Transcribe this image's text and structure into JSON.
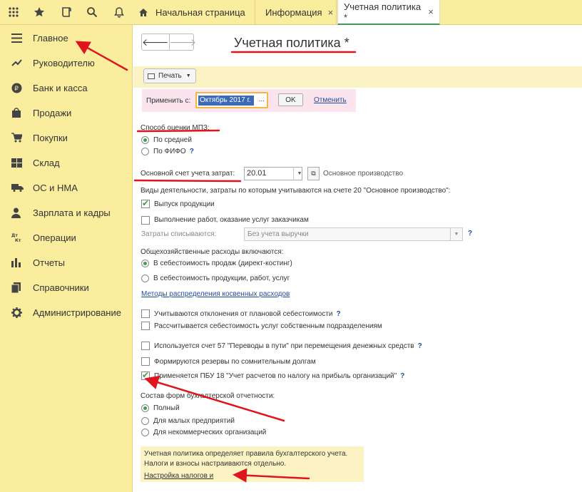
{
  "topbar": {
    "icons": [
      "apps-grid-icon",
      "star-icon",
      "history-icon",
      "search-icon",
      "bell-icon"
    ],
    "tabs": [
      {
        "label": "Начальная страница",
        "icon": "home-icon"
      },
      {
        "label": "Информация",
        "close": "×"
      },
      {
        "label": "Учетная политика *",
        "close": "×"
      }
    ]
  },
  "sidebar": {
    "items": [
      {
        "label": "Главное",
        "icon": "menu-icon"
      },
      {
        "label": "Руководителю",
        "icon": "trend-icon"
      },
      {
        "label": "Банк и касса",
        "icon": "ruble-icon"
      },
      {
        "label": "Продажи",
        "icon": "bag-icon"
      },
      {
        "label": "Покупки",
        "icon": "cart-icon"
      },
      {
        "label": "Склад",
        "icon": "warehouse-icon"
      },
      {
        "label": "ОС и НМА",
        "icon": "truck-icon"
      },
      {
        "label": "Зарплата и кадры",
        "icon": "person-icon"
      },
      {
        "label": "Операции",
        "icon": "dt-kt-icon"
      },
      {
        "label": "Отчеты",
        "icon": "bar-chart-icon"
      },
      {
        "label": "Справочники",
        "icon": "books-icon"
      },
      {
        "label": "Администрирование",
        "icon": "gear-icon"
      }
    ]
  },
  "main": {
    "back": "🡐",
    "forward": "🡒",
    "title": "Учетная политика *",
    "print_label": "Печать",
    "apply": {
      "label": "Применить с:",
      "value": "Октябрь 2017 г.",
      "dots": "...",
      "ok": "OK",
      "cancel": "Отменить"
    },
    "mpz": {
      "label": "Способ оценки МПЗ:",
      "options": [
        "По средней",
        "По ФИФО"
      ],
      "help": "?"
    },
    "account": {
      "label": "Основной счет учета затрат:",
      "value": "20.01",
      "note": "Основное производство"
    },
    "activities": {
      "label": "Виды деятельности, затраты по которым учитываются на счете 20 \"Основное производство\":",
      "items": [
        "Выпуск продукции",
        "Выполнение работ, оказание услуг заказчикам"
      ],
      "writeoff_label": "Затраты списываются:",
      "writeoff_value": "Без учета выручки",
      "help": "?"
    },
    "overhead": {
      "label": "Общехозяйственные расходы включаются:",
      "options": [
        "В себестоимость продаж (директ-костинг)",
        "В  себестоимость продукции, работ, услуг"
      ],
      "link": "Методы распределения косвенных расходов"
    },
    "checks": [
      {
        "label": "Учитываются отклонения от плановой себестоимости",
        "help": "?"
      },
      {
        "label": "Рассчитывается себестоимость услуг собственным подразделениям",
        "help": ""
      },
      {
        "label": "Используется счет 57 \"Переводы в пути\" при перемещения денежных средств",
        "help": "?"
      },
      {
        "label": "Формируются резервы по сомнительным долгам",
        "help": ""
      },
      {
        "label": "Применяется ПБУ 18 \"Учет расчетов по налогу на прибыль организаций\"",
        "help": "?"
      }
    ],
    "reports": {
      "label": "Состав форм бухгалтерской отчетности:",
      "options": [
        "Полный",
        "Для малых предприятий",
        "Для некоммерческих организаций"
      ]
    },
    "note": {
      "line1": "Учетная политика определяет правила бухгалтерского учета.",
      "line2": "Налоги и взносы настраиваются отдельно.",
      "link": "Настройка налогов и"
    }
  },
  "colors": {
    "accent_red": "#e0141e",
    "panel_yellow": "#fbed9e",
    "check_green": "#3c9e54",
    "link_blue": "#1d4e9e"
  }
}
